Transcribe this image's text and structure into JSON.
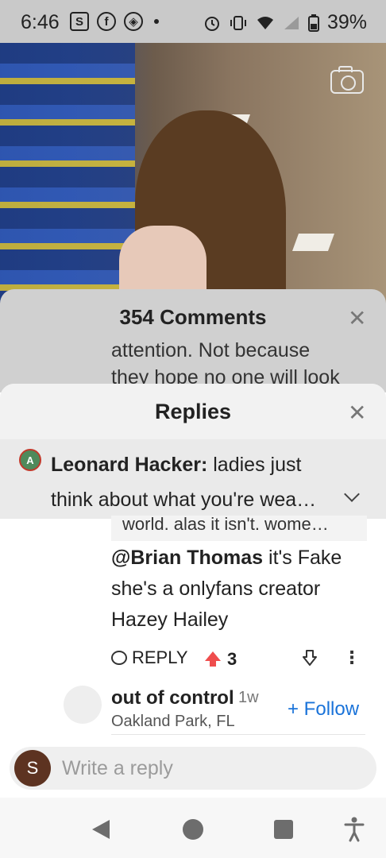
{
  "status_bar": {
    "time": "6:46",
    "left_icons": [
      "S",
      "f",
      "◈"
    ],
    "battery": "39%"
  },
  "comments": {
    "title": "354 Comments",
    "behind_line1": "attention. Not because",
    "behind_line2": "they hope no one will look"
  },
  "replies": {
    "title": "Replies",
    "parent": {
      "avatar_text": "A",
      "author": "Leonard Hacker:",
      "text": " ladies just think about what you're wea…"
    },
    "previous_snippet": "world. alas it isn't. wome…",
    "reply": {
      "mention": "@Brian Thomas",
      "text": " it's Fake she's a onlyfans creator Hazey Hailey",
      "reply_label": "REPLY",
      "upvotes": "3"
    },
    "next_user": {
      "name": "out of control",
      "age": "1w",
      "location": "Oakland Park, FL",
      "follow_label": "+ Follow"
    }
  },
  "composer": {
    "avatar_letter": "S",
    "placeholder": "Write a reply"
  },
  "colors": {
    "accent": "#1a73d9",
    "upvote": "#ef4d4d"
  }
}
